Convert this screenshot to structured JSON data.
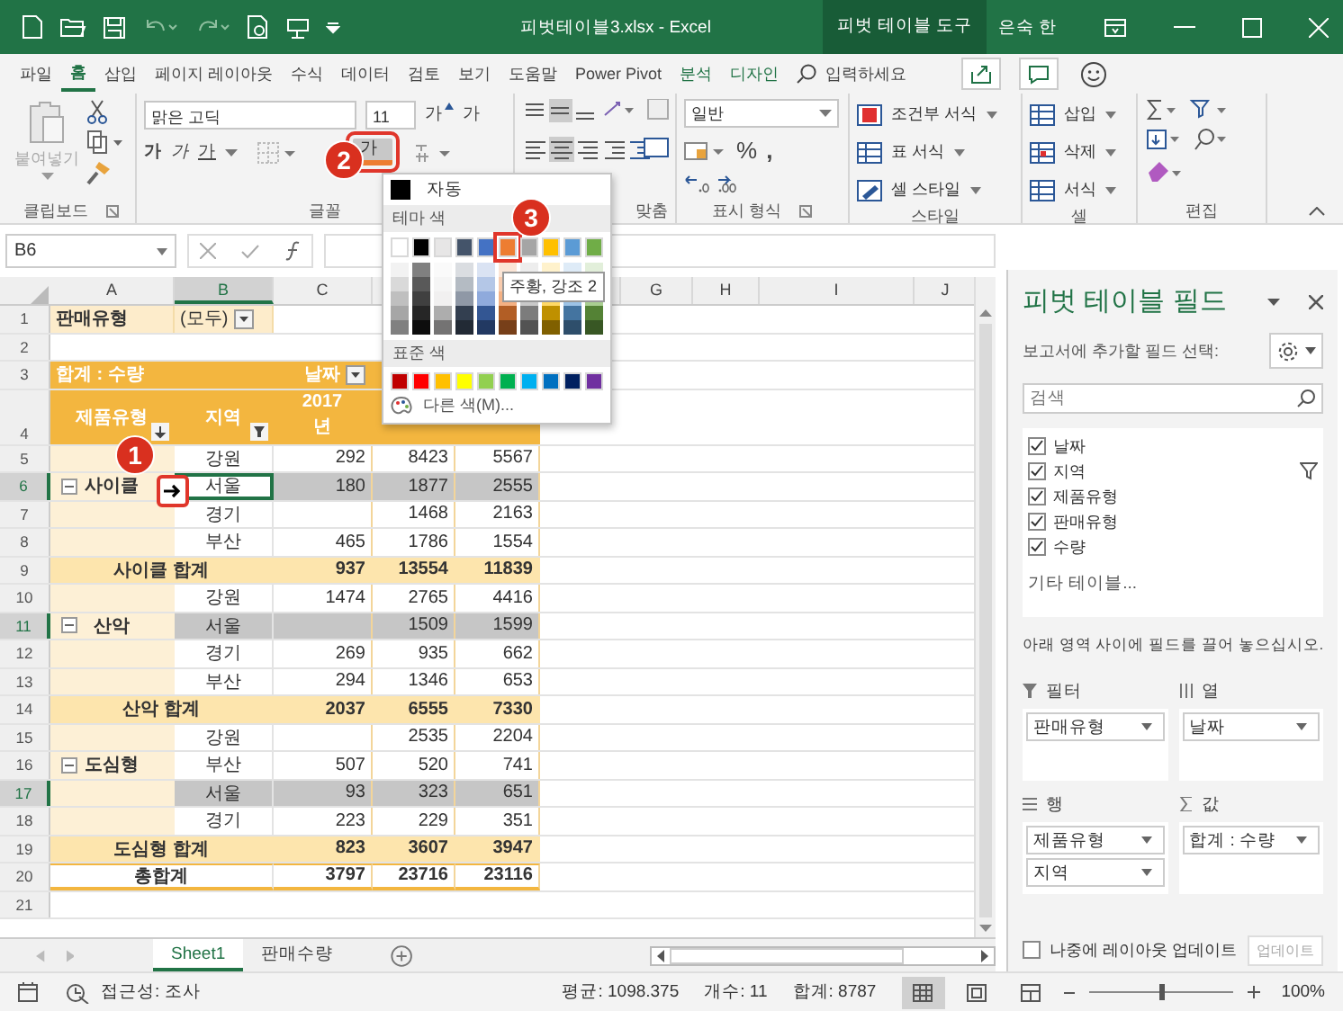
{
  "title_bar": {
    "title": "피벗테이블3.xlsx - Excel",
    "context_title": "피벗 테이블 도구",
    "user": "은숙 한"
  },
  "ribbon_tabs": [
    {
      "label": "파일",
      "selected": false,
      "kind": "normal"
    },
    {
      "label": "홈",
      "selected": true,
      "kind": "normal"
    },
    {
      "label": "삽입",
      "selected": false,
      "kind": "normal"
    },
    {
      "label": "페이지 레이아웃",
      "selected": false,
      "kind": "normal"
    },
    {
      "label": "수식",
      "selected": false,
      "kind": "normal"
    },
    {
      "label": "데이터",
      "selected": false,
      "kind": "normal"
    },
    {
      "label": "검토",
      "selected": false,
      "kind": "normal"
    },
    {
      "label": "보기",
      "selected": false,
      "kind": "normal"
    },
    {
      "label": "도움말",
      "selected": false,
      "kind": "normal"
    },
    {
      "label": "Power Pivot",
      "selected": false,
      "kind": "normal"
    },
    {
      "label": "분석",
      "selected": false,
      "kind": "context"
    },
    {
      "label": "디자인",
      "selected": false,
      "kind": "context"
    }
  ],
  "tell_me": {
    "placeholder": "입력하세요"
  },
  "clipboard": {
    "paste": "붙여넣기",
    "group": "클립보드"
  },
  "font": {
    "name": "맑은 고딕",
    "size": "11",
    "grow": "가",
    "shrink": "가",
    "styles": [
      {
        "label": "가",
        "kind": "bold"
      },
      {
        "label": "가",
        "kind": "italic"
      },
      {
        "label": "가",
        "kind": "underline"
      }
    ],
    "color_button": "가",
    "group": "글꼴"
  },
  "alignment": {
    "group": "맞춤"
  },
  "number": {
    "format": "일반",
    "percent": "%",
    "comma": ",",
    "group": "표시 형식"
  },
  "styles": {
    "items": [
      {
        "label": "조건부 서식",
        "kind": "conditional"
      },
      {
        "label": "표 서식",
        "kind": "table"
      },
      {
        "label": "셀 스타일",
        "kind": "cell"
      }
    ],
    "group": "스타일"
  },
  "cells": {
    "items": [
      {
        "label": "삽입",
        "kind": "insert"
      },
      {
        "label": "삭제",
        "kind": "delete"
      },
      {
        "label": "서식",
        "kind": "format"
      }
    ],
    "group": "셀"
  },
  "editing": {
    "group": "편집"
  },
  "formula_bar": {
    "name_box": "B6"
  },
  "sheet": {
    "columns": [
      "A",
      "B",
      "C",
      null,
      null,
      null,
      "G",
      "H",
      "I",
      "J"
    ],
    "rows": [
      {
        "num": "1",
        "kind": "filter",
        "cells": [
          "판매유형",
          "(모두)"
        ]
      },
      {
        "num": "2",
        "kind": "blank"
      },
      {
        "num": "3",
        "kind": "pivot-head",
        "cells": [
          "합계 : 수량",
          null,
          "날짜"
        ]
      },
      {
        "num": "4",
        "kind": "pivot-labels",
        "cells": [
          "제품유형",
          "지역",
          "2017 년"
        ]
      },
      {
        "num": "5",
        "kind": "item",
        "cells": [
          null,
          "강원",
          "292",
          "8423",
          "5567"
        ]
      },
      {
        "num": "6",
        "kind": "item",
        "highlighted": true,
        "cells": [
          {
            "text": "사이클",
            "expanded": true
          },
          {
            "text": "서울",
            "selected": true
          },
          "180",
          "1877",
          "2555"
        ]
      },
      {
        "num": "7",
        "kind": "item",
        "cells": [
          null,
          "경기",
          null,
          "1468",
          "2163"
        ]
      },
      {
        "num": "8",
        "kind": "item",
        "cells": [
          null,
          "부산",
          "465",
          "1786",
          "1554"
        ]
      },
      {
        "num": "9",
        "kind": "subtotal",
        "cells": [
          "사이클 합계",
          "937",
          "13554",
          "11839"
        ]
      },
      {
        "num": "10",
        "kind": "item",
        "cells": [
          null,
          "강원",
          "1474",
          "2765",
          "4416"
        ]
      },
      {
        "num": "11",
        "kind": "item",
        "highlighted": true,
        "cells": [
          {
            "text": "산악",
            "expanded": true
          },
          "서울",
          null,
          "1509",
          "1599"
        ]
      },
      {
        "num": "12",
        "kind": "item",
        "cells": [
          null,
          "경기",
          "269",
          "935",
          "662"
        ]
      },
      {
        "num": "13",
        "kind": "item",
        "cells": [
          null,
          "부산",
          "294",
          "1346",
          "653"
        ]
      },
      {
        "num": "14",
        "kind": "subtotal",
        "cells": [
          "산악 합계",
          "2037",
          "6555",
          "7330"
        ]
      },
      {
        "num": "15",
        "kind": "item",
        "cells": [
          null,
          "강원",
          null,
          "2535",
          "2204"
        ]
      },
      {
        "num": "16",
        "kind": "item",
        "cells": [
          {
            "text": "도심형",
            "expanded": true
          },
          "부산",
          "507",
          "520",
          "741"
        ]
      },
      {
        "num": "17",
        "kind": "item",
        "highlighted": true,
        "cells": [
          null,
          "서울",
          "93",
          "323",
          "651"
        ]
      },
      {
        "num": "18",
        "kind": "item",
        "cells": [
          null,
          "경기",
          "223",
          "229",
          "351"
        ]
      },
      {
        "num": "19",
        "kind": "subtotal",
        "cells": [
          "도심형 합계",
          "823",
          "3607",
          "3947"
        ]
      },
      {
        "num": "20",
        "kind": "grand",
        "cells": [
          "총합계",
          "3797",
          "23716",
          "23116"
        ]
      },
      {
        "num": "21",
        "kind": "blank"
      }
    ]
  },
  "color_picker": {
    "automatic": "자동",
    "theme_heading": "테마 색",
    "theme_colors": [
      {
        "color": "#ffffff",
        "selected": false
      },
      {
        "color": "#000000",
        "selected": false
      },
      {
        "color": "#e7e6e6",
        "selected": false
      },
      {
        "color": "#44546a",
        "selected": false
      },
      {
        "color": "#4472c4",
        "selected": false
      },
      {
        "color": "#ed7d31",
        "selected": true
      },
      {
        "color": "#a5a5a5",
        "selected": false
      },
      {
        "color": "#ffc000",
        "selected": false
      },
      {
        "color": "#5b9bd5",
        "selected": false
      },
      {
        "color": "#70ad47",
        "selected": false
      }
    ],
    "standard_heading": "표준 색",
    "standard_colors": [
      {
        "color": "#c00000"
      },
      {
        "color": "#ff0000"
      },
      {
        "color": "#ffc000"
      },
      {
        "color": "#ffff00"
      },
      {
        "color": "#92d050"
      },
      {
        "color": "#00b050"
      },
      {
        "color": "#00b0f0"
      },
      {
        "color": "#0070c0"
      },
      {
        "color": "#002060"
      },
      {
        "color": "#7030a0"
      }
    ],
    "more": "다른 색(M)...",
    "tooltip": "주황, 강조 2"
  },
  "callouts": [
    {
      "label": "1"
    },
    {
      "label": "2"
    },
    {
      "label": "3"
    }
  ],
  "sheet_tabs": [
    {
      "label": "Sheet1",
      "selected": true
    },
    {
      "label": "판매수량",
      "selected": false
    }
  ],
  "field_panel": {
    "title": "피벗 테이블 필드",
    "prompt": "보고서에 추가할 필드 선택:",
    "search": {
      "placeholder": "검색"
    },
    "fields": [
      {
        "label": "날짜",
        "checked": true,
        "filtered": false
      },
      {
        "label": "지역",
        "checked": true,
        "filtered": true
      },
      {
        "label": "제품유형",
        "checked": true,
        "filtered": false
      },
      {
        "label": "판매유형",
        "checked": true,
        "filtered": false
      },
      {
        "label": "수량",
        "checked": true,
        "filtered": false
      }
    ],
    "more_tables": "기타 테이블...",
    "instruction": "아래 영역 사이에 필드를 끌어 놓으십시오.",
    "areas": [
      {
        "label": "필터",
        "kind": "filter",
        "items": [
          "판매유형"
        ]
      },
      {
        "label": "열",
        "kind": "columns",
        "items": [
          "날짜"
        ]
      },
      {
        "label": "행",
        "kind": "rows",
        "items": [
          "제품유형",
          "지역"
        ]
      },
      {
        "label": "값",
        "kind": "values",
        "items": [
          "합계 : 수량"
        ]
      }
    ],
    "defer": {
      "label": "나중에 레이아웃 업데이트",
      "checked": false
    },
    "update_button": "업데이트"
  },
  "status_bar": {
    "accessibility": "접근성: 조사",
    "stats": [
      "평균: 1098.375",
      "개수: 11",
      "합계: 8787"
    ],
    "zoom": {
      "level": 0.5,
      "reading": "100%"
    }
  }
}
